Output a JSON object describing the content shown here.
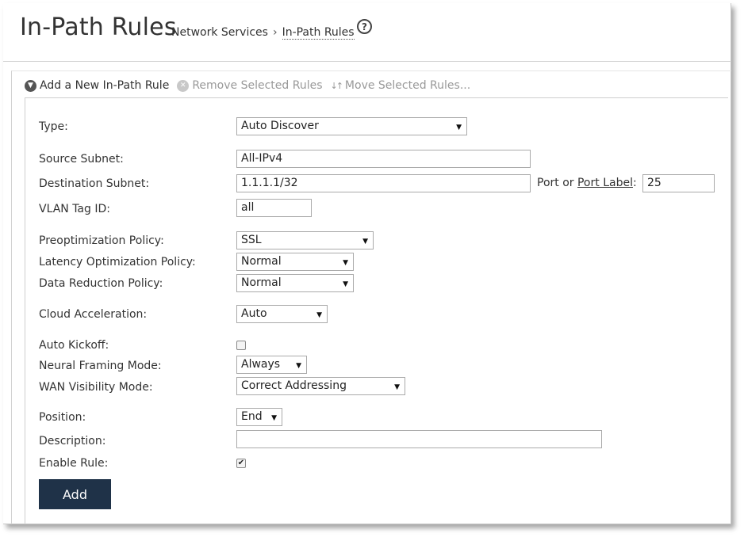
{
  "header": {
    "title": "In-Path Rules",
    "breadcrumb_parent": "Network Services",
    "breadcrumb_separator": "›",
    "breadcrumb_current": "In-Path Rules",
    "help_glyph": "?"
  },
  "toolbar": {
    "add_label": "Add a New In-Path Rule",
    "remove_label": "Remove Selected Rules",
    "move_label": "Move Selected Rules..."
  },
  "form": {
    "type": {
      "label": "Type:",
      "value": "Auto Discover"
    },
    "source_subnet": {
      "label": "Source Subnet:",
      "value": "All-IPv4"
    },
    "destination_subnet": {
      "label": "Destination Subnet:",
      "value": "1.1.1.1/32"
    },
    "port": {
      "prefix": "Port or ",
      "link": "Port Label",
      "suffix": ":",
      "value": "25"
    },
    "vlan": {
      "label": "VLAN Tag ID:",
      "value": "all"
    },
    "preopt": {
      "label": "Preoptimization Policy:",
      "value": "SSL"
    },
    "latency": {
      "label": "Latency Optimization Policy:",
      "value": "Normal"
    },
    "data_reduction": {
      "label": "Data Reduction Policy:",
      "value": "Normal"
    },
    "cloud": {
      "label": "Cloud Acceleration:",
      "value": "Auto"
    },
    "auto_kickoff": {
      "label": "Auto Kickoff:",
      "checked": false
    },
    "neural": {
      "label": "Neural Framing Mode:",
      "value": "Always"
    },
    "wan": {
      "label": "WAN Visibility Mode:",
      "value": "Correct Addressing"
    },
    "position": {
      "label": "Position:",
      "value": "End"
    },
    "description": {
      "label": "Description:",
      "value": ""
    },
    "enable": {
      "label": "Enable Rule:",
      "checked": true
    },
    "add_button": "Add"
  },
  "colors": {
    "add_button_bg": "#1f3248",
    "disabled_text": "#999999"
  }
}
